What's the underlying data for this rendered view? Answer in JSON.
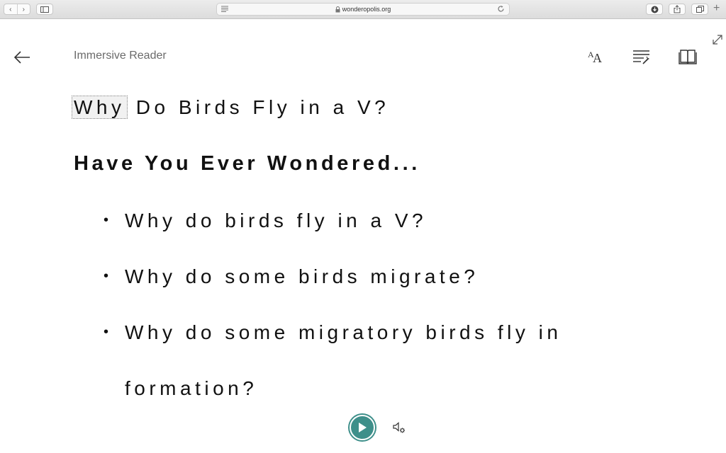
{
  "browser": {
    "url": "wonderopolis.org",
    "nav_back": "‹",
    "nav_forward": "›"
  },
  "reader": {
    "title": "Immersive Reader",
    "heading_highlighted_word": "Why",
    "heading_rest": " Do Birds Fly in a V?",
    "subheading": "Have You Ever Wondered...",
    "bullets": [
      "Why do birds fly in a V?",
      "Why do some birds migrate?",
      "Why do some migratory birds fly in formation?"
    ]
  },
  "colors": {
    "play_button": "#3e8f8a"
  },
  "icons": {
    "back": "back-arrow-icon",
    "text_preferences": "text-size-icon",
    "grammar_options": "grammar-options-icon",
    "reading_preferences": "book-icon",
    "play": "play-icon",
    "voice_settings": "speaker-gear-icon",
    "expand": "expand-icon"
  }
}
